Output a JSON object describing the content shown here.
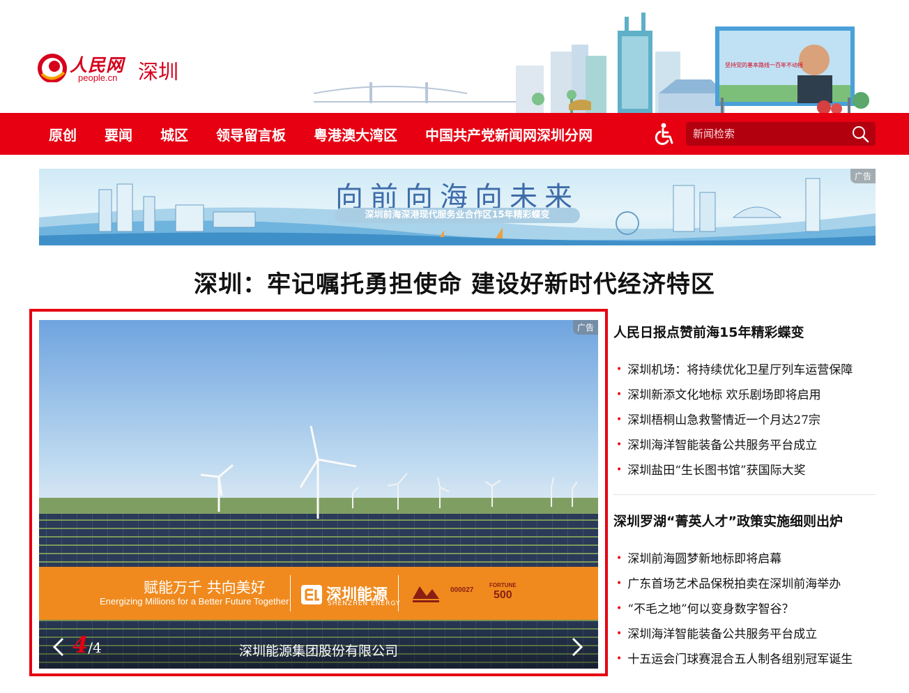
{
  "header": {
    "logo_cn": "人民网",
    "logo_en": "people.cn",
    "city": "深圳",
    "billboard_text": "坚持党的基本路线一百年不动摇"
  },
  "nav": {
    "items": [
      "原创",
      "要闻",
      "城区",
      "领导留言板",
      "粤港澳大湾区",
      "中国共产党新闻网深圳分网"
    ],
    "accessibility_icon": "wheelchair-icon",
    "search_placeholder": "新闻检索",
    "search_icon": "search-icon"
  },
  "banner": {
    "title": "向前向海向未来",
    "subtitle": "深圳前海深港现代服务业合作区15年精彩蝶变",
    "ad_label": "广告"
  },
  "headline": "深圳：牢记嘱托勇担使命 建设好新时代经济特区",
  "carousel": {
    "ad_label": "广告",
    "promo_slogan": "赋能万千 共向美好",
    "promo_slogan_en": "Energizing Millions for a Better Future Together",
    "brand_cn": "深圳能源",
    "brand_en": "SHENZHEN ENERGY",
    "stock_code": "000027",
    "fortune_label": "FORTUNE",
    "fortune_500": "500",
    "caption": "深圳能源集团股份有限公司",
    "current": "4",
    "separator": "/",
    "total": "4",
    "prev_icon": "chevron-left-icon",
    "next_icon": "chevron-right-icon",
    "colors": {
      "frame": "#e60012",
      "promo": "#f08a1e"
    }
  },
  "news": {
    "groups": [
      {
        "headline": "人民日报点赞前海15年精彩蝶变",
        "items": [
          "深圳机场：将持续优化卫星厅列车运营保障",
          "深圳新添文化地标 欢乐剧场即将启用",
          "深圳梧桐山急救警情近一个月达27宗",
          "深圳海洋智能装备公共服务平台成立",
          "深圳盐田“生长图书馆”获国际大奖"
        ]
      },
      {
        "headline": "深圳罗湖“菁英人才”政策实施细则出炉",
        "items": [
          "深圳前海圆梦新地标即将启幕",
          "广东首场艺术品保税拍卖在深圳前海举办",
          "“不毛之地”何以变身数字智谷？",
          "深圳海洋智能装备公共服务平台成立",
          "十五运会门球赛混合五人制各组别冠军诞生"
        ]
      }
    ]
  },
  "theme": {
    "primary": "#e60012",
    "search_bg": "#b3000f"
  }
}
